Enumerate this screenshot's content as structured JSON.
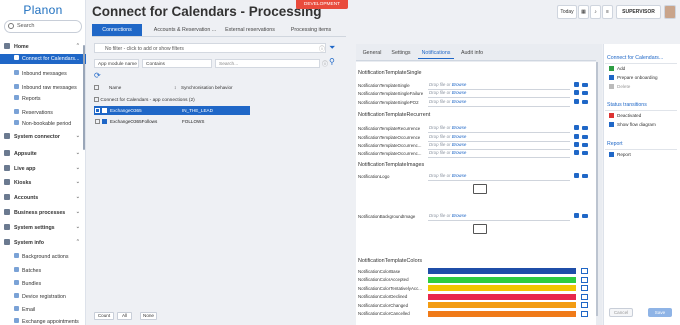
{
  "sidebar": {
    "logo": "Planon",
    "search_placeholder": "Search",
    "items": [
      {
        "label": "Home",
        "icon": "home-icon",
        "type": "top",
        "open": true
      },
      {
        "label": "Connect for Calendars...",
        "icon": "connector-icon",
        "type": "sub",
        "selected": true
      },
      {
        "label": "Inbound messages",
        "icon": "inbox-icon",
        "type": "sub"
      },
      {
        "label": "Inbound raw messages",
        "icon": "inbox-icon",
        "type": "sub"
      },
      {
        "label": "Reports",
        "icon": "report-icon",
        "type": "sub"
      },
      {
        "label": "Reservations",
        "icon": "calendar-icon",
        "type": "sub"
      },
      {
        "label": "Non-bookable period",
        "icon": "calendar-icon",
        "type": "sub"
      },
      {
        "label": "System connector",
        "icon": "plug-icon",
        "type": "top"
      },
      {
        "label": "Appsuite",
        "icon": "apps-icon",
        "type": "top"
      },
      {
        "label": "Live app",
        "icon": "phone-icon",
        "type": "top"
      },
      {
        "label": "Kiosks",
        "icon": "kiosk-icon",
        "type": "top"
      },
      {
        "label": "Accounts",
        "icon": "accounts-icon",
        "type": "top"
      },
      {
        "label": "Business processes",
        "icon": "process-icon",
        "type": "top"
      },
      {
        "label": "System settings",
        "icon": "gear-icon",
        "type": "top"
      },
      {
        "label": "System info",
        "icon": "info-icon",
        "type": "top",
        "open": true
      },
      {
        "label": "Background actions",
        "icon": "gear-icon",
        "type": "sub"
      },
      {
        "label": "Batches",
        "icon": "batch-icon",
        "type": "sub"
      },
      {
        "label": "Bundles",
        "icon": "bundle-icon",
        "type": "sub"
      },
      {
        "label": "Device registration",
        "icon": "device-icon",
        "type": "sub"
      },
      {
        "label": "Email",
        "icon": "email-icon",
        "type": "sub"
      },
      {
        "label": "Exchange appointments",
        "icon": "calendar-icon",
        "type": "sub"
      }
    ]
  },
  "header": {
    "title": "Connect for Calendars - Processing",
    "env_badge": "DEVELOPMENT",
    "today_label": "Today",
    "user_label": "SUPERVISOR"
  },
  "left_panel": {
    "tabs": [
      {
        "label": "Connections",
        "active": true
      },
      {
        "label": "Accounts & Reservation ...",
        "active": false
      },
      {
        "label": "External reservations",
        "active": false
      },
      {
        "label": "Processing items",
        "active": false
      }
    ],
    "filter_placeholder": "No filter - click to add or show filters",
    "search_field": "App module name",
    "search_op": "Contains",
    "search_value": "Search...",
    "columns": {
      "name": "Name",
      "sync": "Synchronisation behavior"
    },
    "group_label": "Connect for Calendars - app connections (2)",
    "rows": [
      {
        "name": "ExchangeO365",
        "sync": "IN_THE_LEAD",
        "selected": true
      },
      {
        "name": "ExchangeO365Follows",
        "sync": "FOLLOWS",
        "selected": false
      }
    ],
    "footer_buttons": [
      "Count",
      "All",
      "None"
    ]
  },
  "detail": {
    "tabs": [
      {
        "label": "General",
        "active": false
      },
      {
        "label": "Settings",
        "active": false
      },
      {
        "label": "Notifications",
        "active": true
      },
      {
        "label": "Audit info",
        "active": false
      }
    ],
    "drop_text": "Drop file or",
    "browse_text": "Browse",
    "sections": [
      {
        "title": "NotificationTemplateSingle",
        "fields": [
          "NotificationTemplateSingle",
          "NotificationTemplateSingleFailure",
          "NotificationTemplateSinglePO2"
        ]
      },
      {
        "title": "NotificationTemplateRecurrent",
        "fields": [
          "NotificationTemplateRecurrence",
          "NotificationTemplateOccurrence",
          "NotificationTemplateOccurrenc...",
          "NotificationTemplateOccurrenc..."
        ]
      },
      {
        "title": "NotificationTemplateImages",
        "fields": [
          "NotificationLogo",
          "NotificationBackgroundImage"
        ]
      },
      {
        "title": "NotificationTemplateColors",
        "fields": []
      }
    ],
    "colors": [
      {
        "label": "NotificationColorBase",
        "color": "#1f4ea8"
      },
      {
        "label": "NotificationColorAccepted",
        "color": "#2ecc40"
      },
      {
        "label": "NotificationColorTentativelyAcc...",
        "color": "#f2c500"
      },
      {
        "label": "NotificationColorDeclined",
        "color": "#e8274b"
      },
      {
        "label": "NotificationColorChanged",
        "color": "#f39c12"
      },
      {
        "label": "NotificationColorCancelled",
        "color": "#f07a18"
      }
    ]
  },
  "actions": {
    "groups": [
      {
        "title": "Connect for Calendars...",
        "items": [
          {
            "label": "Add",
            "icon": "plus-icon",
            "disabled": false
          },
          {
            "label": "Prepare onboarding",
            "icon": "onboarding-icon",
            "disabled": false
          },
          {
            "label": "Delete",
            "icon": "delete-icon",
            "disabled": true
          }
        ]
      },
      {
        "title": "Status transitions",
        "items": [
          {
            "label": "Deactivated",
            "icon": "deactivate-icon",
            "disabled": false
          },
          {
            "label": "Show flow diagram",
            "icon": "flow-icon",
            "disabled": false
          }
        ]
      },
      {
        "title": "Report",
        "items": [
          {
            "label": "Report",
            "icon": "report-icon",
            "disabled": false
          }
        ]
      }
    ],
    "cancel_label": "Cancel",
    "save_label": "Save"
  }
}
